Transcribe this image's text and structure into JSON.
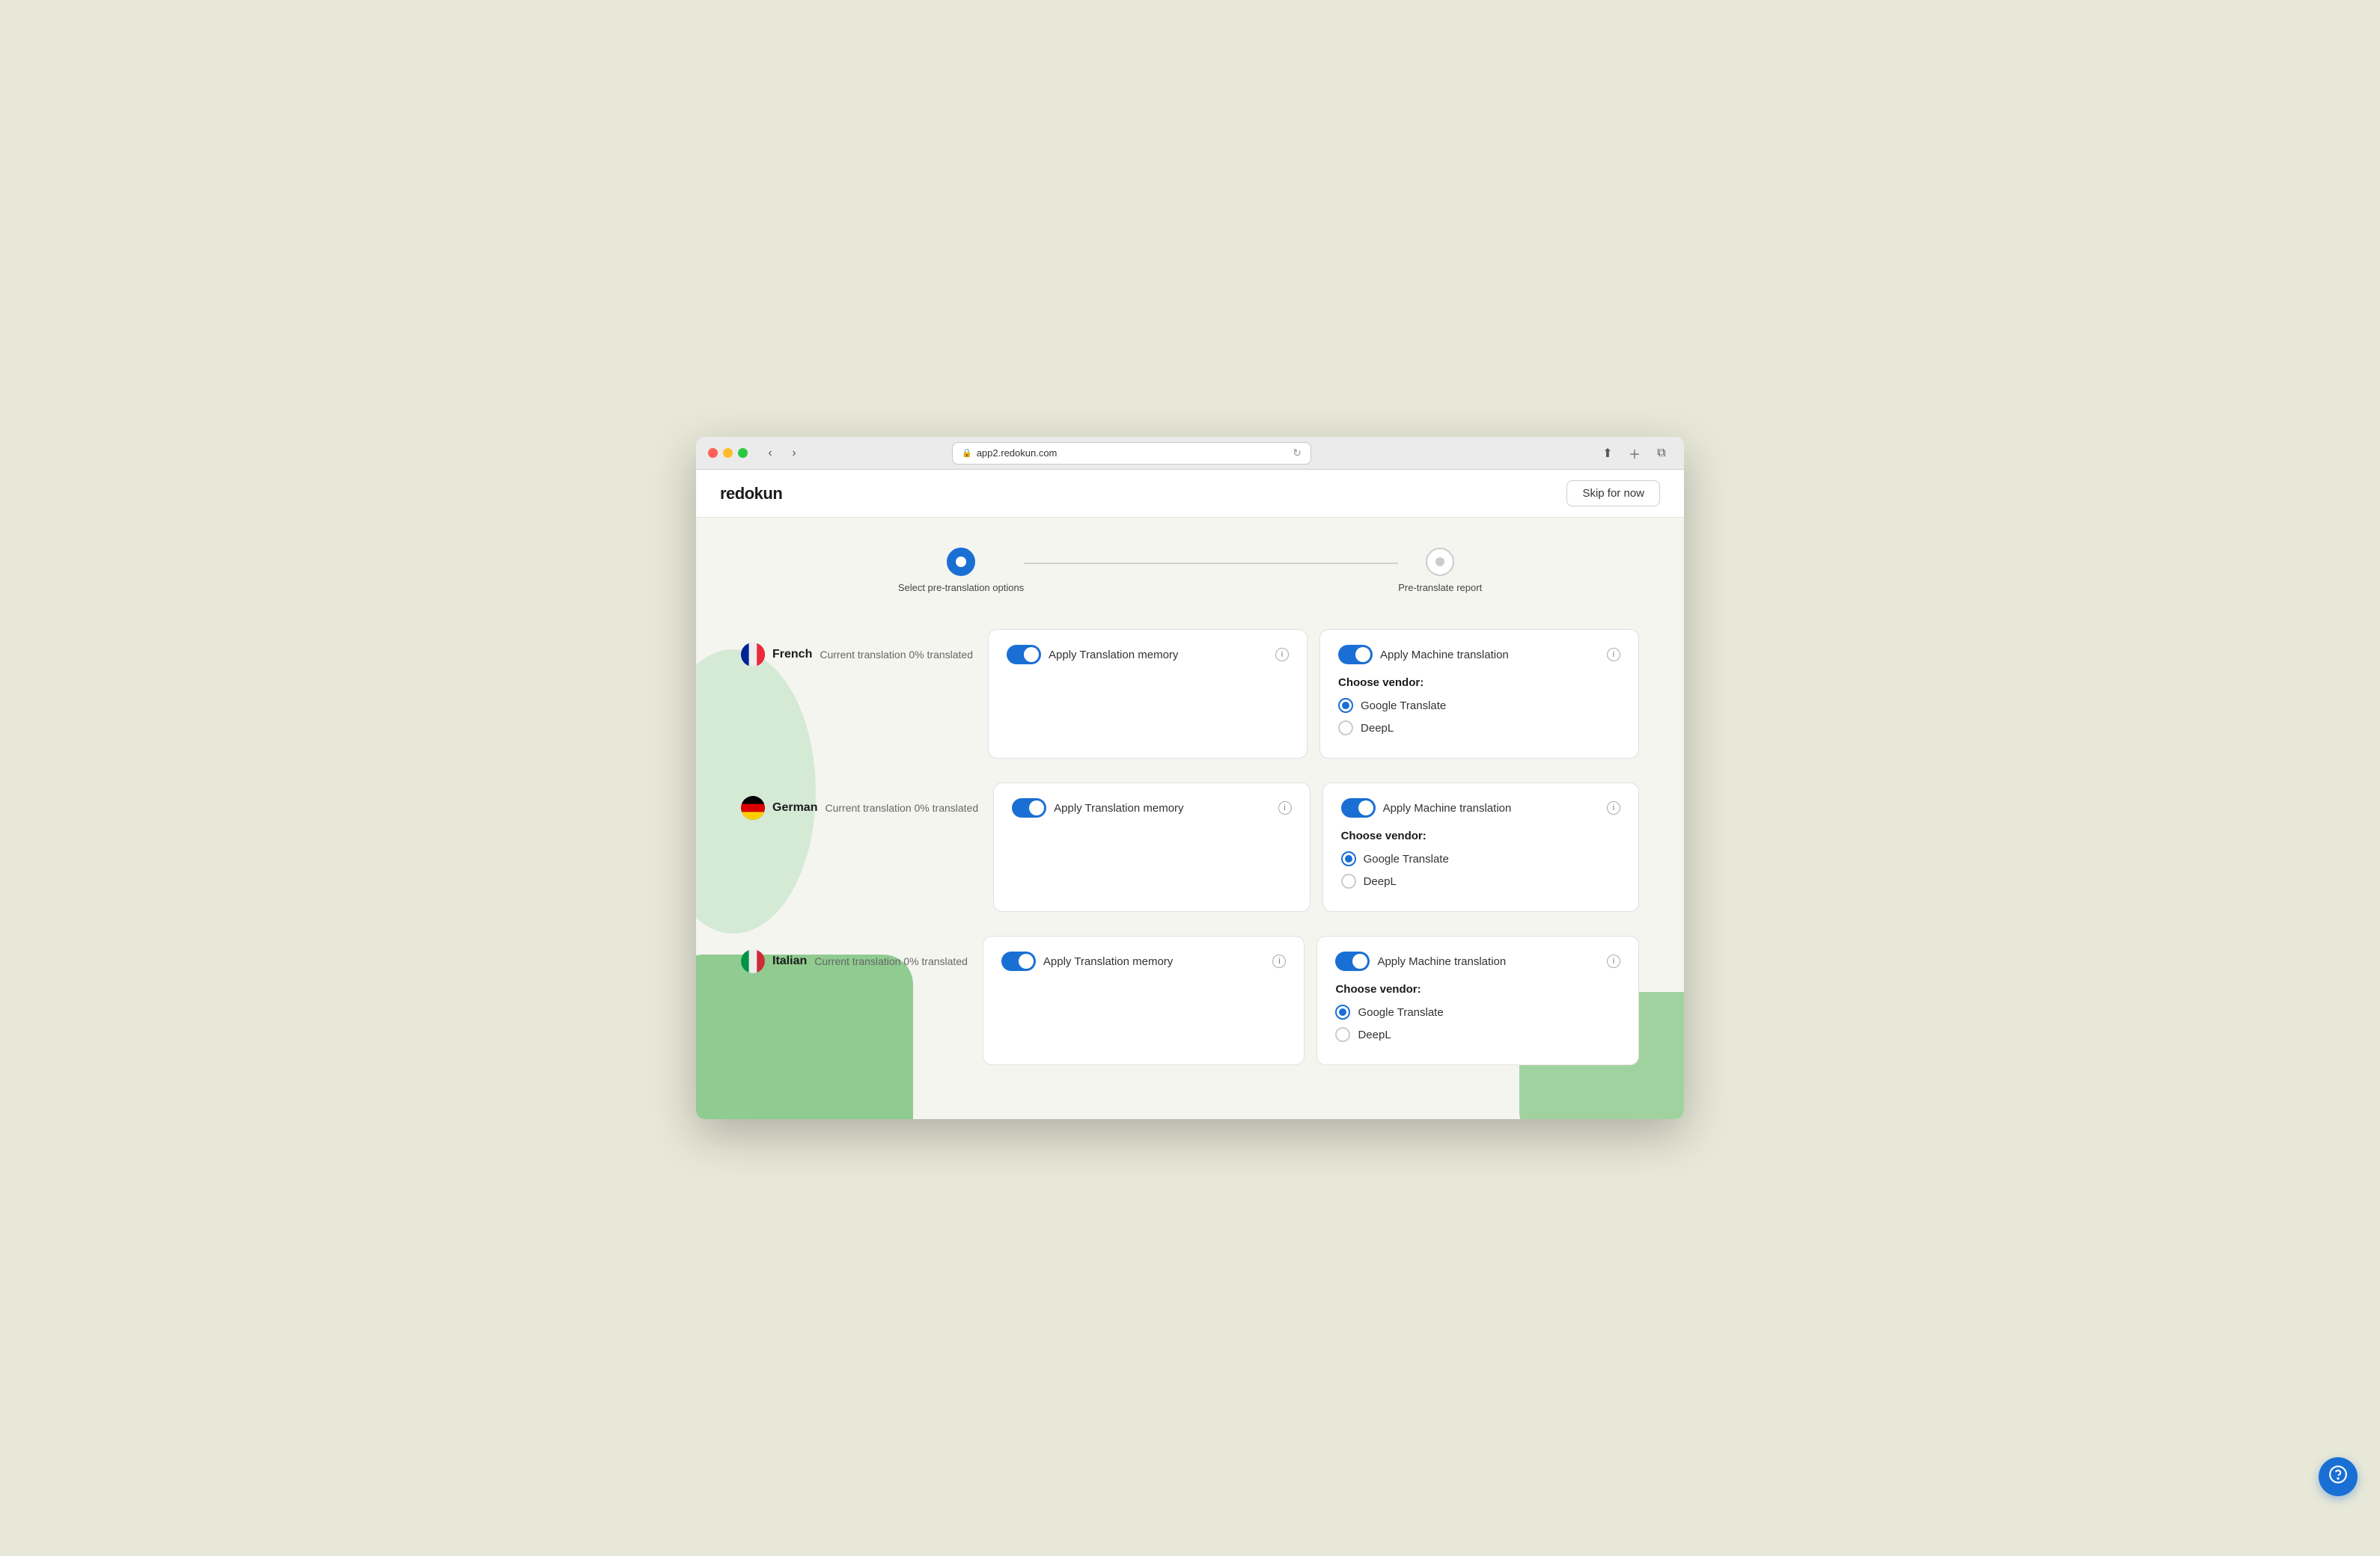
{
  "browser": {
    "url": "app2.redokun.com",
    "reload_icon": "↻"
  },
  "header": {
    "logo": "redokun",
    "skip_label": "Skip for now"
  },
  "stepper": {
    "step1": {
      "label": "Select pre-translation options",
      "state": "active"
    },
    "step2": {
      "label": "Pre-translate report",
      "state": "inactive"
    }
  },
  "languages": [
    {
      "id": "french",
      "name": "French",
      "status": "Current translation 0% translated",
      "flag": "french",
      "translation_memory": {
        "label": "Apply Translation memory",
        "enabled": true
      },
      "machine_translation": {
        "label": "Apply Machine translation",
        "enabled": true,
        "vendor_title": "Choose vendor:",
        "vendors": [
          {
            "id": "google",
            "label": "Google Translate",
            "selected": true
          },
          {
            "id": "deepl",
            "label": "DeepL",
            "selected": false
          }
        ]
      }
    },
    {
      "id": "german",
      "name": "German",
      "status": "Current translation 0% translated",
      "flag": "german",
      "translation_memory": {
        "label": "Apply Translation memory",
        "enabled": true
      },
      "machine_translation": {
        "label": "Apply Machine translation",
        "enabled": true,
        "vendor_title": "Choose vendor:",
        "vendors": [
          {
            "id": "google",
            "label": "Google Translate",
            "selected": true
          },
          {
            "id": "deepl",
            "label": "DeepL",
            "selected": false
          }
        ]
      }
    },
    {
      "id": "italian",
      "name": "Italian",
      "status": "Current translation 0% translated",
      "flag": "italian",
      "translation_memory": {
        "label": "Apply Translation memory",
        "enabled": true
      },
      "machine_translation": {
        "label": "Apply Machine translation",
        "enabled": true,
        "vendor_title": "Choose vendor:",
        "vendors": [
          {
            "id": "google",
            "label": "Google Translate",
            "selected": true
          },
          {
            "id": "deepl",
            "label": "DeepL",
            "selected": false
          }
        ]
      }
    }
  ],
  "support": {
    "icon": "⊛"
  }
}
